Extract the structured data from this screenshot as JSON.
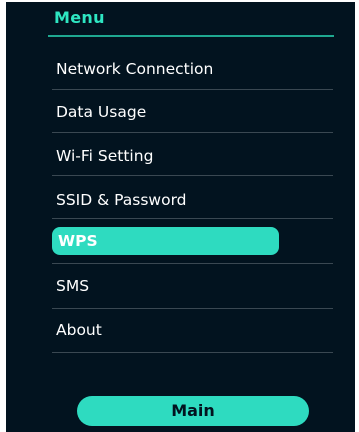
{
  "menu": {
    "title": "Menu",
    "items": [
      {
        "label": "Network Connection",
        "active": false
      },
      {
        "label": "Data Usage",
        "active": false
      },
      {
        "label": "Wi-Fi Setting",
        "active": false
      },
      {
        "label": "SSID & Password",
        "active": false
      },
      {
        "label": "WPS",
        "active": true
      },
      {
        "label": "SMS",
        "active": false
      },
      {
        "label": "About",
        "active": false
      }
    ]
  },
  "footer": {
    "main_label": "Main"
  },
  "colors": {
    "panel_background": "#02131f",
    "accent": "#2edbc0",
    "title_text": "#2ee6c2",
    "divider": "#3a4852",
    "item_text": "#ffffff"
  }
}
